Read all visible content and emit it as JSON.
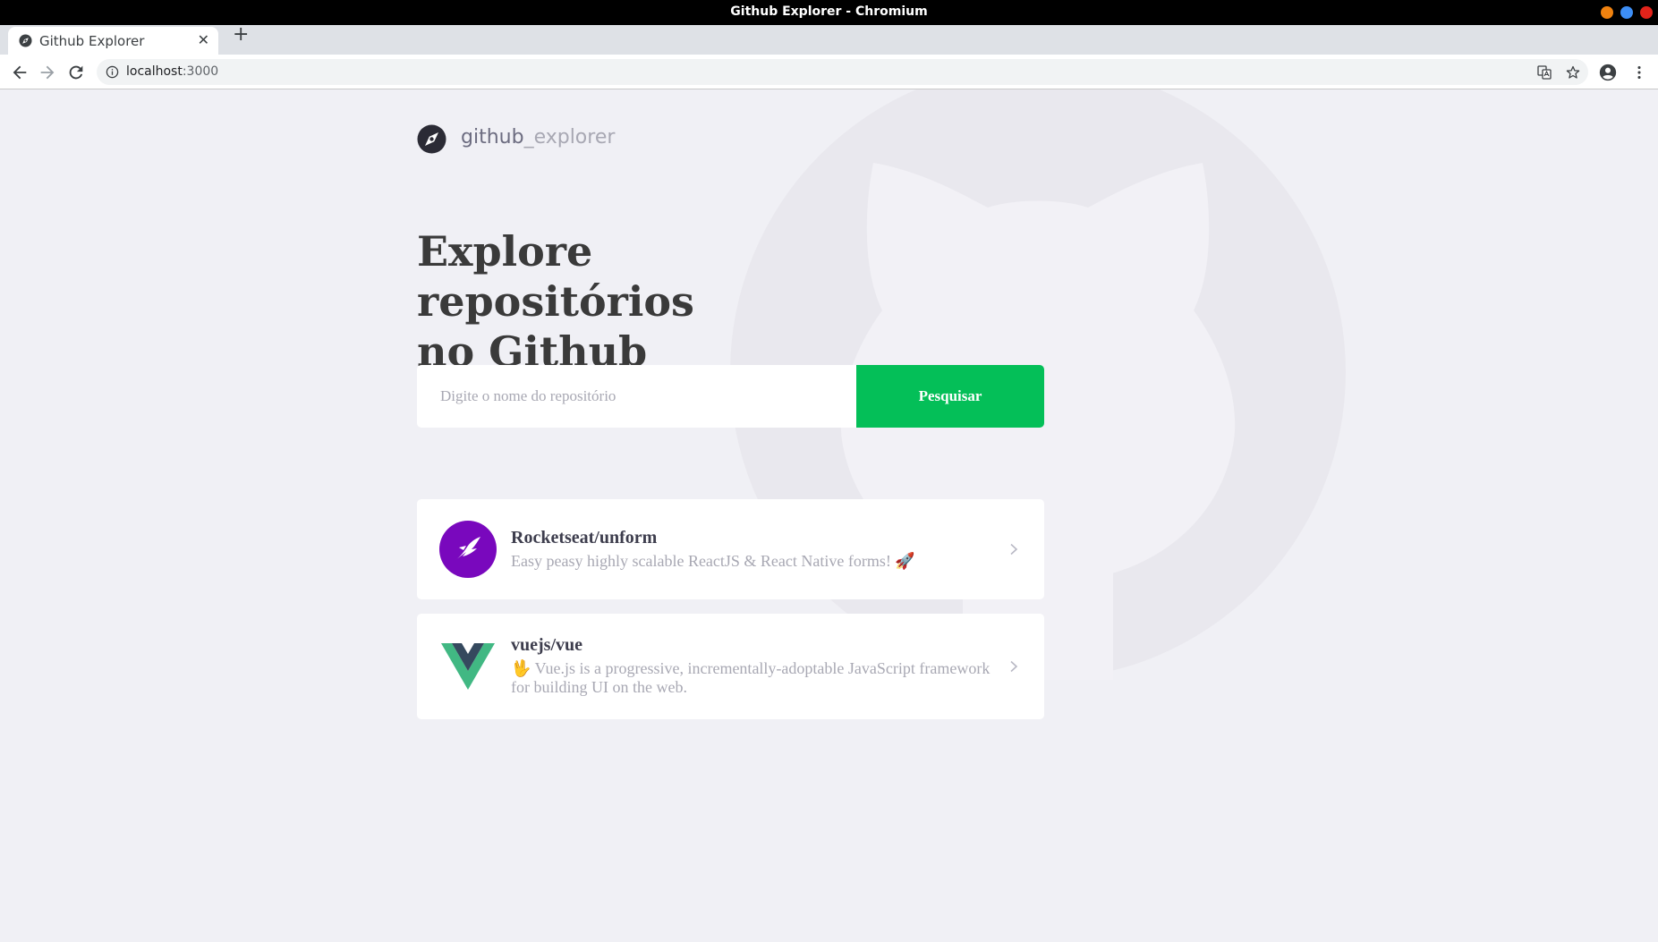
{
  "window": {
    "title": "Github Explorer - Chromium",
    "buttons": [
      "#f0820f",
      "#3d8ef5",
      "#e2231a"
    ]
  },
  "browser": {
    "tab_title": "Github Explorer",
    "tab_close": "✕",
    "new_tab": "+",
    "url_host": "localhost",
    "url_port": ":3000"
  },
  "app": {
    "logo_main": "github",
    "logo_accent": "_explorer",
    "headline_line1": "Explore repositórios",
    "headline_line2": "no Github",
    "search": {
      "placeholder": "Digite o nome do repositório",
      "value": "",
      "button_label": "Pesquisar"
    },
    "repositories": [
      {
        "name": "Rocketseat/unform",
        "description": "Easy peasy highly scalable ReactJS & React Native forms! 🚀",
        "avatar_icon": "unform-logo-icon"
      },
      {
        "name": "vuejs/vue",
        "description": "🖖 Vue.js is a progressive, incrementally-adoptable JavaScript framework for building UI on the web.",
        "avatar_icon": "vue-logo-icon"
      }
    ]
  },
  "colors": {
    "page_bg": "#f0f0f5",
    "accent_green": "#04bf58",
    "heading": "#3a3a3a",
    "muted": "#a8a8b3"
  }
}
